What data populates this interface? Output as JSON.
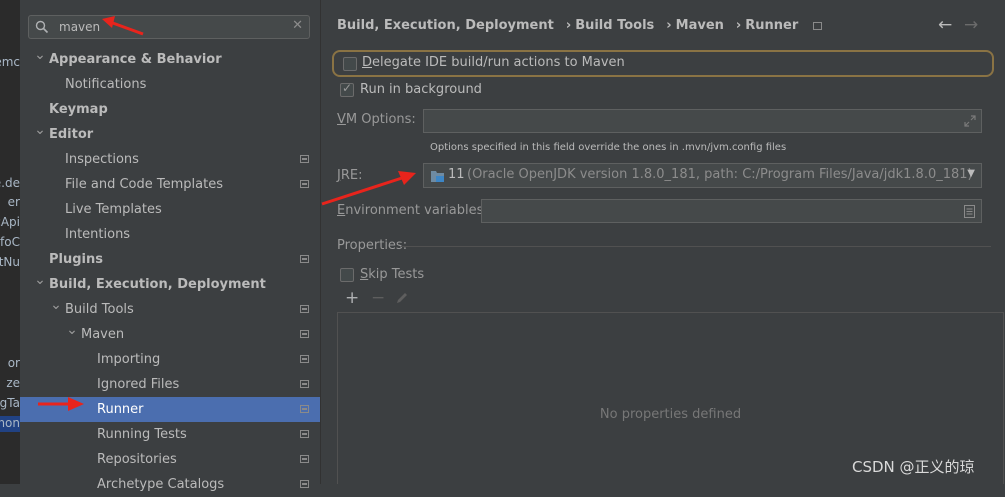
{
  "editor_sliver": [
    "emc",
    "e.de",
    "er",
    "cApi",
    "foC",
    "atNu",
    "or",
    "ze",
    "ngTa",
    "mon"
  ],
  "search": {
    "value": "maven"
  },
  "tree": [
    {
      "label": "Appearance & Behavior",
      "bold": true,
      "indent": 0,
      "arrow": "down"
    },
    {
      "label": "Notifications",
      "bold": false,
      "indent": 2,
      "arrow": ""
    },
    {
      "label": "Keymap",
      "bold": true,
      "indent": 0,
      "arrow": ""
    },
    {
      "label": "Editor",
      "bold": true,
      "indent": 0,
      "arrow": "down"
    },
    {
      "label": "Inspections",
      "bold": false,
      "indent": 2,
      "arrow": "",
      "page_icon": true
    },
    {
      "label": "File and Code Templates",
      "bold": false,
      "indent": 2,
      "arrow": "",
      "page_icon": true
    },
    {
      "label": "Live Templates",
      "bold": false,
      "indent": 2,
      "arrow": ""
    },
    {
      "label": "Intentions",
      "bold": false,
      "indent": 2,
      "arrow": ""
    },
    {
      "label": "Plugins",
      "bold": true,
      "indent": 0,
      "arrow": "",
      "page_icon": true
    },
    {
      "label": "Build, Execution, Deployment",
      "bold": true,
      "indent": 0,
      "arrow": "down"
    },
    {
      "label": "Build Tools",
      "bold": false,
      "indent": 1,
      "arrow": "down",
      "page_icon": true
    },
    {
      "label": "Maven",
      "bold": false,
      "indent": 2,
      "arrow": "down",
      "page_icon": true
    },
    {
      "label": "Importing",
      "bold": false,
      "indent": 3,
      "arrow": "",
      "page_icon": true
    },
    {
      "label": "Ignored Files",
      "bold": false,
      "indent": 3,
      "arrow": "",
      "page_icon": true
    },
    {
      "label": "Runner",
      "bold": false,
      "indent": 3,
      "arrow": "",
      "page_icon": true,
      "selected": true
    },
    {
      "label": "Running Tests",
      "bold": false,
      "indent": 3,
      "arrow": "",
      "page_icon": true
    },
    {
      "label": "Repositories",
      "bold": false,
      "indent": 3,
      "arrow": "",
      "page_icon": true
    },
    {
      "label": "Archetype Catalogs",
      "bold": false,
      "indent": 3,
      "arrow": "",
      "page_icon": true
    }
  ],
  "breadcrumb": [
    "Build, Execution, Deployment",
    "Build Tools",
    "Maven",
    "Runner"
  ],
  "runner": {
    "delegate_label": "Delegate IDE build/run actions to Maven",
    "delegate_checked": false,
    "background_label": "Run in background",
    "background_checked": true,
    "vm_options_label": "VM Options:",
    "vm_options_value": "",
    "vm_hint": "Options specified in this field override the ones in .mvn/jvm.config files",
    "jre_label": "JRE:",
    "jre_version": "11",
    "jre_detail": "(Oracle OpenJDK version 1.8.0_181, path: C:/Program Files/Java/jdk1.8.0_181)",
    "env_label": "Environment variables:",
    "env_value": "",
    "properties_label": "Properties:",
    "skip_tests_label": "Skip Tests",
    "skip_tests_checked": false,
    "empty_props": "No properties defined"
  },
  "watermark": "CSDN @正义的琼",
  "colors": {
    "selection": "#4b6eaf",
    "highlight_border": "#8a7344",
    "annotation_arrow": "#e8241c"
  }
}
